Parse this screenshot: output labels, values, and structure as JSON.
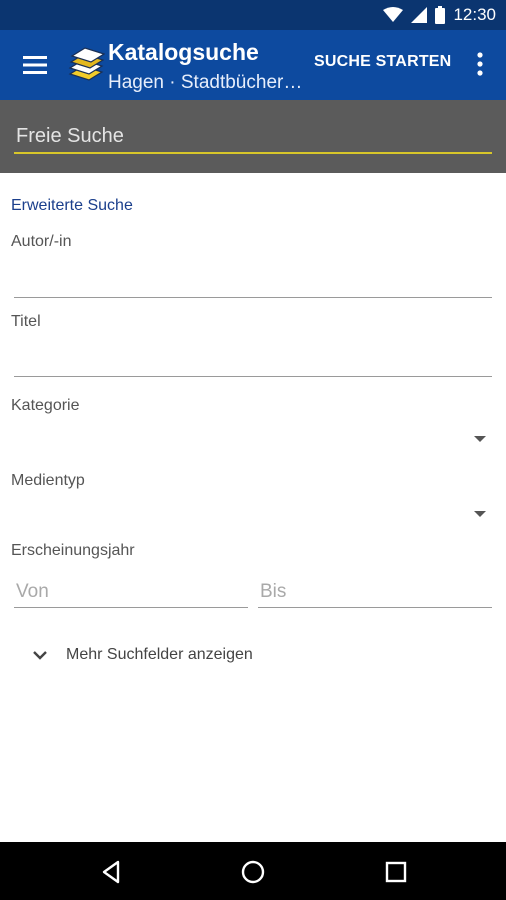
{
  "status_bar": {
    "time": "12:30",
    "icons": [
      "wifi-icon",
      "signal-icon",
      "battery-icon"
    ]
  },
  "app_bar": {
    "title": "Katalogsuche",
    "subtitle": "Hagen · Stadtbücher…",
    "action_label": "SUCHE STARTEN",
    "menu_icon": "hamburger-menu-icon",
    "overflow_icon": "overflow-menu-icon",
    "logo_icon": "book-stack-logo"
  },
  "search": {
    "placeholder": "Freie Suche",
    "value": ""
  },
  "advanced": {
    "title": "Erweiterte Suche",
    "author_label": "Autor/-in",
    "author_value": "",
    "title_label": "Titel",
    "title_value": "",
    "category_label": "Kategorie",
    "category_value": "",
    "media_label": "Medientyp",
    "media_value": "",
    "year_label": "Erscheinungsjahr",
    "year_from_placeholder": "Von",
    "year_to_placeholder": "Bis",
    "more_fields_label": "Mehr Suchfelder anzeigen"
  },
  "nav_bar": {
    "buttons": [
      "back-icon",
      "home-icon",
      "recents-icon"
    ]
  },
  "colors": {
    "status_bar": "#0b3570",
    "app_bar": "#0d4a9f",
    "search_bar": "#5b5b5b",
    "accent_underline": "#d8c62a",
    "section_title": "#1b3f8c"
  }
}
